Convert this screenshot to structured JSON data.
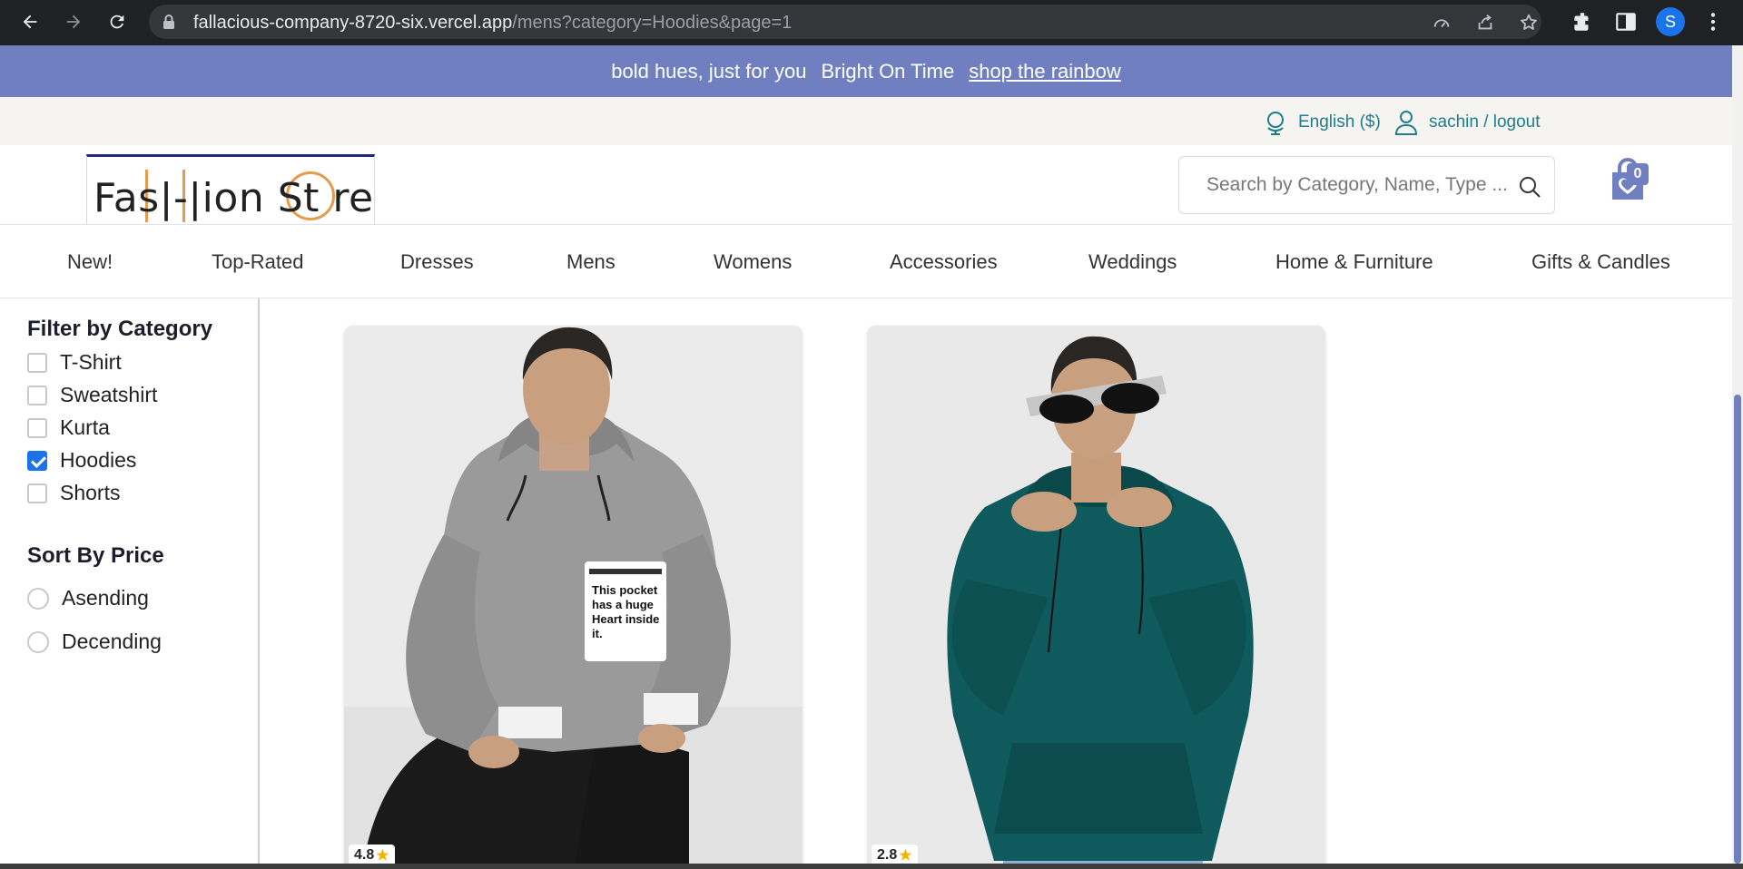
{
  "browser": {
    "url_host": "fallacious-company-8720-six.vercel.app",
    "url_path": "/mens?category=Hoodies&page=1",
    "profile_initial": "S"
  },
  "promo": {
    "text": "bold hues, just for you",
    "tagline": "Bright On Time",
    "link": "shop the rainbow"
  },
  "utility": {
    "language": "English ($)",
    "account": "sachin / logout"
  },
  "header": {
    "logo_text": "Fas|-|ion St re",
    "search_placeholder": "Search by Category, Name, Type ...",
    "cart_count": "0"
  },
  "nav": [
    {
      "label": "New!"
    },
    {
      "label": "Top-Rated"
    },
    {
      "label": "Dresses"
    },
    {
      "label": "Mens"
    },
    {
      "label": "Womens"
    },
    {
      "label": "Accessories"
    },
    {
      "label": "Weddings"
    },
    {
      "label": "Home & Furniture"
    },
    {
      "label": "Gifts & Candles"
    }
  ],
  "filters": {
    "category_heading": "Filter by Category",
    "categories": [
      {
        "label": "T-Shirt",
        "checked": false
      },
      {
        "label": "Sweatshirt",
        "checked": false
      },
      {
        "label": "Kurta",
        "checked": false
      },
      {
        "label": "Hoodies",
        "checked": true
      },
      {
        "label": "Shorts",
        "checked": false
      }
    ],
    "sort_heading": "Sort By Price",
    "sort_options": [
      {
        "label": "Asending"
      },
      {
        "label": "Decending"
      }
    ]
  },
  "products": [
    {
      "rating": "4.8",
      "hoodie_color": "grey",
      "pocket_text": [
        "This pocket",
        "has a huge",
        "Heart inside",
        "it."
      ]
    },
    {
      "rating": "2.8",
      "hoodie_color": "teal"
    }
  ],
  "colors": {
    "accent": "#6f7fc0",
    "link_teal": "#1e7d8c",
    "logo_orange": "#e79a4a",
    "logo_navy": "#1f2a7a"
  }
}
